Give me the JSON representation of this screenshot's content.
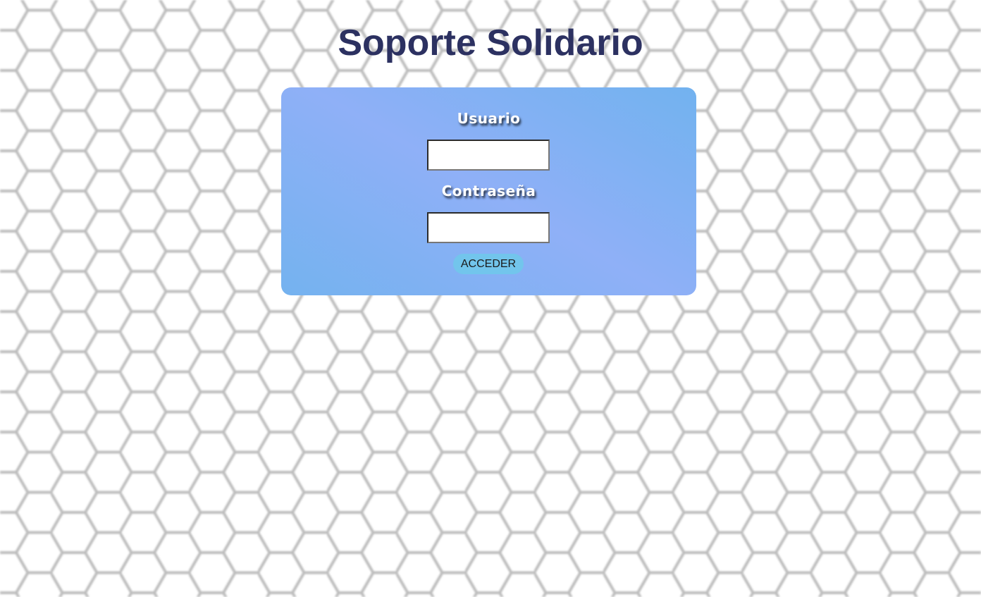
{
  "page": {
    "title": "Soporte Solidario",
    "title_color": "#2c3161",
    "background_pattern": "hexagon-grid"
  },
  "login": {
    "user_label": "Usuario",
    "user_value": "",
    "password_label": "Contraseña",
    "password_value": "",
    "submit_label": "ACCEDER",
    "panel_gradient": [
      "#74b2ef",
      "#8fb0f7",
      "#72b2ef"
    ],
    "button_color": "#72c5ec"
  }
}
